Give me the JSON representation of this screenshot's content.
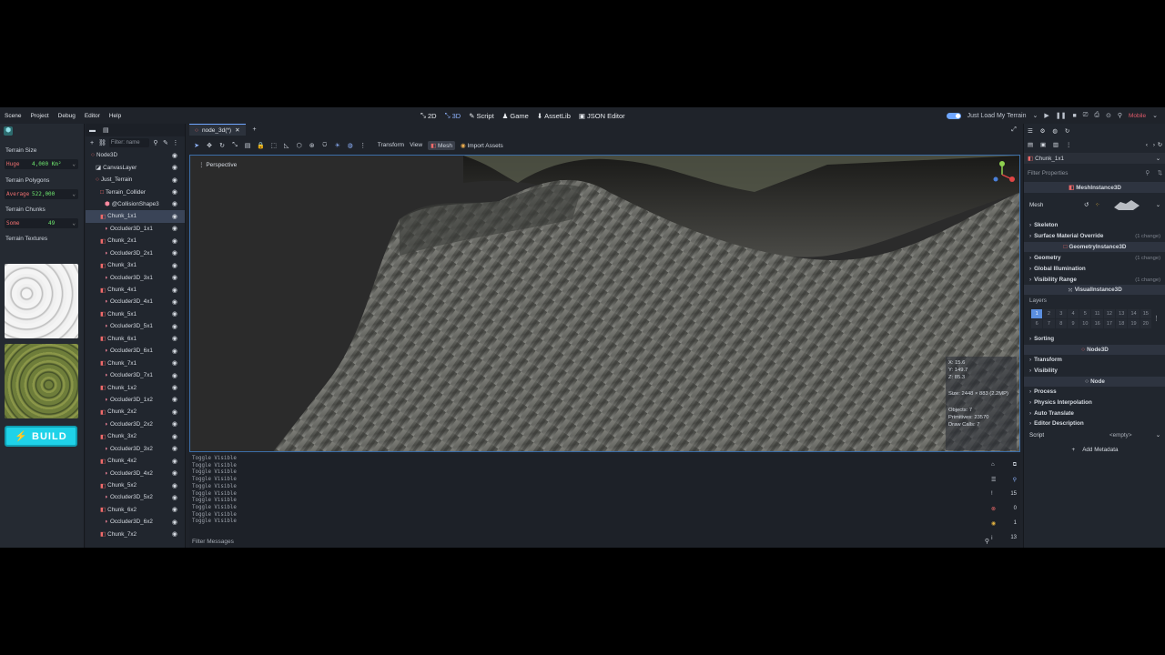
{
  "menus": [
    "Scene",
    "Project",
    "Debug",
    "Editor",
    "Help"
  ],
  "main_switch": [
    "2D",
    "3D",
    "Script",
    "Game",
    "AssetLib",
    "JSON Editor"
  ],
  "run": {
    "label": "Just Load My Terrain",
    "mode": "Mobile"
  },
  "custom_panel": {
    "size_label": "Terrain Size",
    "size_key": "Huge",
    "size_val": "4,000 Km²",
    "poly_label": "Terrain Polygons",
    "poly_key": "Average",
    "poly_val": "522,000",
    "chunk_label": "Terrain Chunks",
    "chunk_key": "Some",
    "chunk_val": "49",
    "tex_label": "Terrain Textures",
    "build": "BUILD"
  },
  "scene": {
    "filter_placeholder": "Filter: name",
    "nodes": [
      {
        "label": "Node3D",
        "indent": 0,
        "icon": "node3d-icon",
        "eye": true
      },
      {
        "label": "CanvasLayer",
        "indent": 1,
        "icon": "canvaslayer-icon",
        "eye": true
      },
      {
        "label": "Just_Terrain",
        "indent": 1,
        "icon": "node3d-icon",
        "eye": true
      },
      {
        "label": "Terrain_Collider",
        "indent": 2,
        "icon": "staticbody-icon",
        "eye": true
      },
      {
        "label": "@CollisionShape3",
        "indent": 3,
        "icon": "collision-icon",
        "eye": true
      },
      {
        "label": "Chunk_1x1",
        "indent": 2,
        "icon": "mesh-icon",
        "eye": true,
        "selected": true
      },
      {
        "label": "Occluder3D_1x1",
        "indent": 3,
        "icon": "occluder-icon",
        "eye": true
      },
      {
        "label": "Chunk_2x1",
        "indent": 2,
        "icon": "mesh-icon",
        "eye": true
      },
      {
        "label": "Occluder3D_2x1",
        "indent": 3,
        "icon": "occluder-icon",
        "eye": true
      },
      {
        "label": "Chunk_3x1",
        "indent": 2,
        "icon": "mesh-icon",
        "eye": true
      },
      {
        "label": "Occluder3D_3x1",
        "indent": 3,
        "icon": "occluder-icon",
        "eye": true
      },
      {
        "label": "Chunk_4x1",
        "indent": 2,
        "icon": "mesh-icon",
        "eye": true
      },
      {
        "label": "Occluder3D_4x1",
        "indent": 3,
        "icon": "occluder-icon",
        "eye": true
      },
      {
        "label": "Chunk_5x1",
        "indent": 2,
        "icon": "mesh-icon",
        "eye": true
      },
      {
        "label": "Occluder3D_5x1",
        "indent": 3,
        "icon": "occluder-icon",
        "eye": true
      },
      {
        "label": "Chunk_6x1",
        "indent": 2,
        "icon": "mesh-icon",
        "eye": true
      },
      {
        "label": "Occluder3D_6x1",
        "indent": 3,
        "icon": "occluder-icon",
        "eye": true
      },
      {
        "label": "Chunk_7x1",
        "indent": 2,
        "icon": "mesh-icon",
        "eye": true
      },
      {
        "label": "Occluder3D_7x1",
        "indent": 3,
        "icon": "occluder-icon",
        "eye": true
      },
      {
        "label": "Chunk_1x2",
        "indent": 2,
        "icon": "mesh-icon",
        "eye": true
      },
      {
        "label": "Occluder3D_1x2",
        "indent": 3,
        "icon": "occluder-icon",
        "eye": true
      },
      {
        "label": "Chunk_2x2",
        "indent": 2,
        "icon": "mesh-icon",
        "eye": true
      },
      {
        "label": "Occluder3D_2x2",
        "indent": 3,
        "icon": "occluder-icon",
        "eye": true
      },
      {
        "label": "Chunk_3x2",
        "indent": 2,
        "icon": "mesh-icon",
        "eye": true
      },
      {
        "label": "Occluder3D_3x2",
        "indent": 3,
        "icon": "occluder-icon",
        "eye": true
      },
      {
        "label": "Chunk_4x2",
        "indent": 2,
        "icon": "mesh-icon",
        "eye": true
      },
      {
        "label": "Occluder3D_4x2",
        "indent": 3,
        "icon": "occluder-icon",
        "eye": true
      },
      {
        "label": "Chunk_5x2",
        "indent": 2,
        "icon": "mesh-icon",
        "eye": true
      },
      {
        "label": "Occluder3D_5x2",
        "indent": 3,
        "icon": "occluder-icon",
        "eye": true
      },
      {
        "label": "Chunk_6x2",
        "indent": 2,
        "icon": "mesh-icon",
        "eye": true
      },
      {
        "label": "Occluder3D_6x2",
        "indent": 3,
        "icon": "occluder-icon",
        "eye": true
      },
      {
        "label": "Chunk_7x2",
        "indent": 2,
        "icon": "mesh-icon",
        "eye": true
      }
    ]
  },
  "viewport": {
    "tab": "node_3d(*)",
    "tool_labels": {
      "transform": "Transform",
      "view": "View",
      "mesh": "Mesh",
      "import": "Import Assets"
    },
    "perspective": "Perspective",
    "stats": {
      "x": "X: 15.6",
      "y": "Y: 149.7",
      "z": "Z: 85.3",
      "size": "Size: 2448 × 883 (2.2MP)",
      "objects": "Objects: 7",
      "primitives": "Primitives: 23570",
      "drawcalls": "Draw Calls: 7"
    }
  },
  "output": {
    "lines": [
      "Toggle Visible",
      "Toggle Visible",
      "Toggle Visible",
      "Toggle Visible",
      "Toggle Visible",
      "Toggle Visible",
      "Toggle Visible",
      "Toggle Visible",
      "Toggle Visible",
      "Toggle Visible"
    ],
    "filter": "Filter Messages",
    "counts": {
      "messages": "15",
      "errors": "0",
      "warnings": "1",
      "info": "13"
    }
  },
  "inspector": {
    "node": "Chunk_1x1",
    "filter": "Filter Properties",
    "class": "MeshInstance3D",
    "mesh_label": "Mesh",
    "skeleton": "Skeleton",
    "surface": "Surface Material Override",
    "surface_chg": "(1 change)",
    "geometry_class": "GeometryInstance3D",
    "geometry": "Geometry",
    "geometry_chg": "(1 change)",
    "gi": "Global Illumination",
    "visrange": "Visibility Range",
    "visrange_chg": "(1 change)",
    "visual_class": "VisualInstance3D",
    "layers": "Layers",
    "layer_nums": [
      "1",
      "2",
      "3",
      "4",
      "5",
      "11",
      "12",
      "13",
      "14",
      "15",
      "6",
      "7",
      "8",
      "9",
      "10",
      "16",
      "17",
      "18",
      "19",
      "20"
    ],
    "sorting": "Sorting",
    "node3d_class": "Node3D",
    "transform": "Transform",
    "visibility": "Visibility",
    "node_class": "Node",
    "process": "Process",
    "physics": "Physics Interpolation",
    "autotranslate": "Auto Translate",
    "editordesc": "Editor Description",
    "script_label": "Script",
    "script_val": "<empty>",
    "add_meta": "Add Metadata"
  }
}
